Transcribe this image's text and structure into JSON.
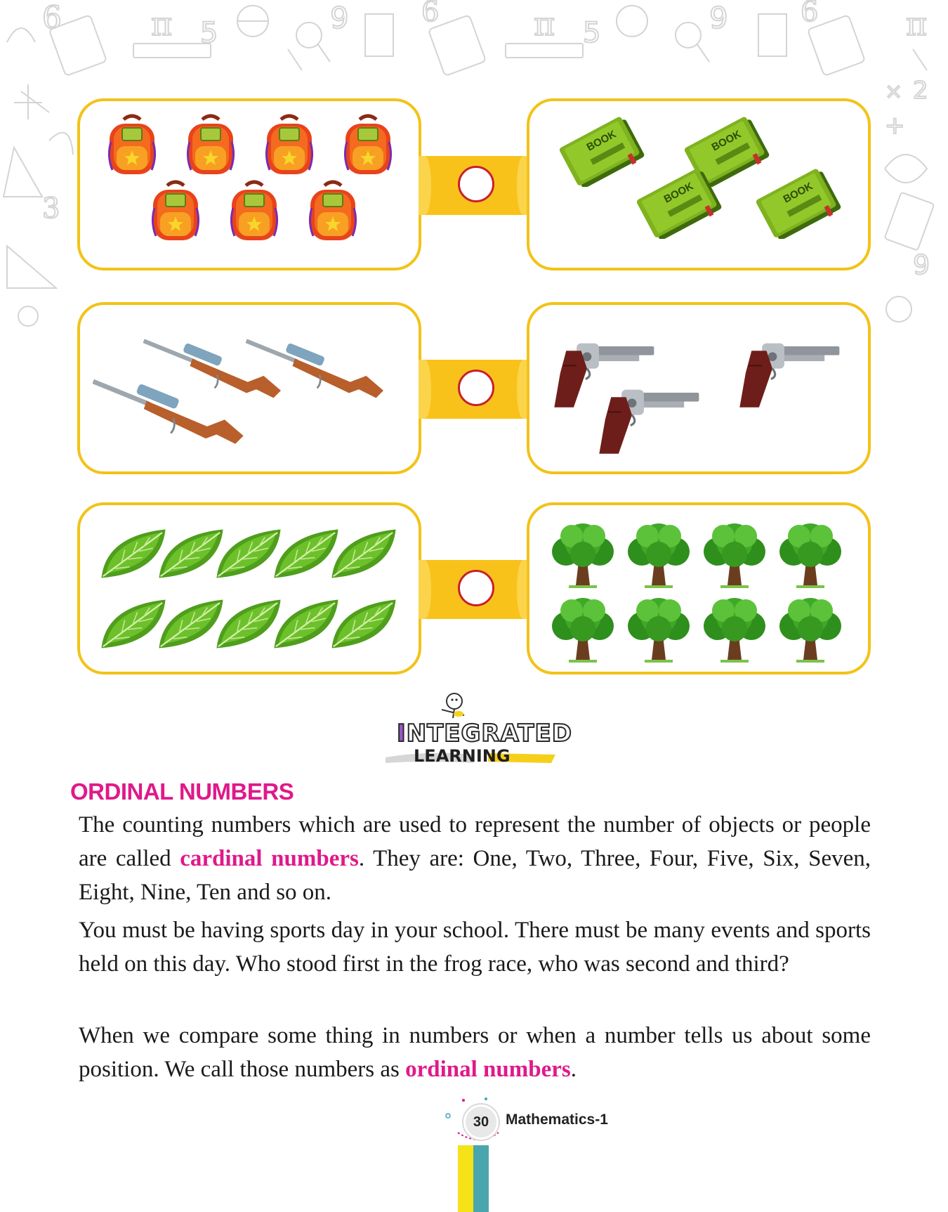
{
  "rows": [
    {
      "left": {
        "item": "backpack-icon",
        "count": 7
      },
      "right": {
        "item": "book-icon",
        "count": 4,
        "label": "BOOK"
      }
    },
    {
      "left": {
        "item": "rifle-icon",
        "count": 3
      },
      "right": {
        "item": "revolver-icon",
        "count": 3
      }
    },
    {
      "left": {
        "item": "leaf-icon",
        "count": 10
      },
      "right": {
        "item": "tree-icon",
        "count": 8
      }
    }
  ],
  "logo": {
    "line1": "INTEGRATED",
    "line2": "LEARNING"
  },
  "section": {
    "title": "ORDINAL NUMBERS"
  },
  "paragraphs": {
    "p1_a": "The counting numbers which are used to represent the number of objects or people are called ",
    "p1_hl": "cardinal numbers",
    "p1_b": ". They are: One, Two, Three, Four, Five, Six, Seven, Eight, Nine, Ten and so on.",
    "p2": "You must be having sports day in your school. There must be many events and sports held on this day. Who stood first in the frog race, who was second and third?",
    "p3_a": "When we compare some thing in numbers or when a number tells us about some position. We call those numbers as ",
    "p3_hl": "ordinal numbers",
    "p3_b": "."
  },
  "footer": {
    "page_number": "30",
    "book": "Mathematics-1"
  },
  "colors": {
    "panel_border": "#f2c318",
    "connector": "#f8c21a",
    "highlight": "#e0198a",
    "circle_border": "#c8202d"
  }
}
